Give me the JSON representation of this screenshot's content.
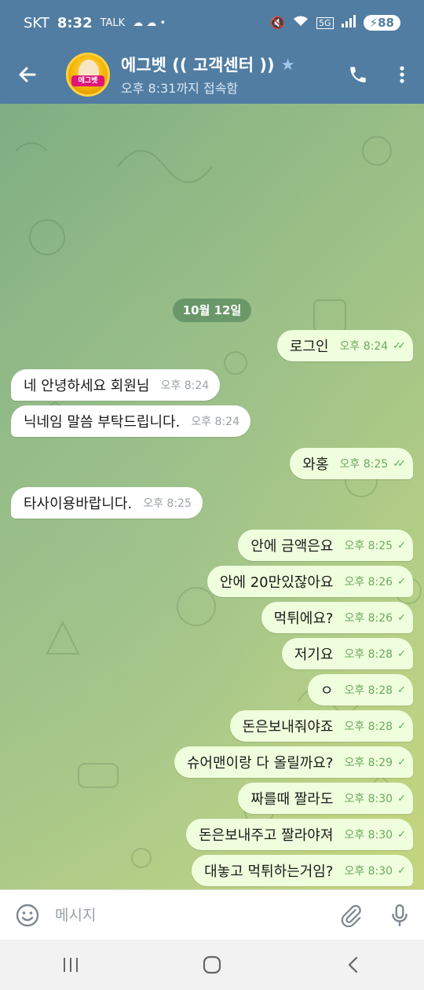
{
  "status_bar": {
    "carrier": "SKT",
    "time": "8:32",
    "talk_badge": "TALK",
    "network": "5G",
    "battery": "88"
  },
  "header": {
    "title": "에그벳 (( 고객센터 ))",
    "last_seen": "오후 8:31까지 접속함",
    "avatar_text": "에그벳",
    "icons": [
      "back-arrow-icon",
      "phone-icon",
      "more-vertical-icon"
    ]
  },
  "chat": {
    "date_chip": "10월 12일",
    "messages": [
      {
        "dir": "out",
        "text": "로그인",
        "time": "오후 8:24",
        "ticks": "✓✓"
      },
      {
        "dir": "in",
        "text": "네 안녕하세요 회원님",
        "time": "오후 8:24"
      },
      {
        "dir": "in",
        "text": "닉네임 말씀 부탁드립니다.",
        "time": "오후 8:24"
      },
      {
        "dir": "out",
        "text": "와홍",
        "time": "오후 8:25",
        "ticks": "✓✓"
      },
      {
        "dir": "in",
        "text": "타사이용바랍니다.",
        "time": "오후 8:25"
      },
      {
        "dir": "out",
        "text": "안에 금액은요",
        "time": "오후 8:25",
        "ticks": "✓"
      },
      {
        "dir": "out",
        "text": "안에 20만있잖아요",
        "time": "오후 8:26",
        "ticks": "✓"
      },
      {
        "dir": "out",
        "text": "먹튀에요?",
        "time": "오후 8:26",
        "ticks": "✓"
      },
      {
        "dir": "out",
        "text": "저기요",
        "time": "오후 8:28",
        "ticks": "✓"
      },
      {
        "dir": "out",
        "text": "ㅇ",
        "time": "오후 8:28",
        "ticks": "✓"
      },
      {
        "dir": "out",
        "text": "돈은보내줘야죠",
        "time": "오후 8:28",
        "ticks": "✓"
      },
      {
        "dir": "out",
        "text": "슈어맨이랑 다 올릴까요?",
        "time": "오후 8:29",
        "ticks": "✓"
      },
      {
        "dir": "out",
        "text": "짜를때 짤라도",
        "time": "오후 8:30",
        "ticks": "✓"
      },
      {
        "dir": "out",
        "text": "돈은보내주고 짤라야져",
        "time": "오후 8:30",
        "ticks": "✓"
      },
      {
        "dir": "out",
        "text": "대놓고 먹튀하는거임?",
        "time": "오후 8:30",
        "ticks": "✓"
      }
    ]
  },
  "input_bar": {
    "placeholder": "메시지",
    "icons": [
      "emoji-icon",
      "attach-icon",
      "mic-icon"
    ]
  },
  "nav_bar": {
    "icons": [
      "recent-apps-icon",
      "home-icon",
      "back-icon"
    ]
  },
  "colors": {
    "header": "#517da2",
    "outgoing_bubble": "#effedd",
    "incoming_bubble": "#ffffff",
    "check": "#5fae57"
  }
}
